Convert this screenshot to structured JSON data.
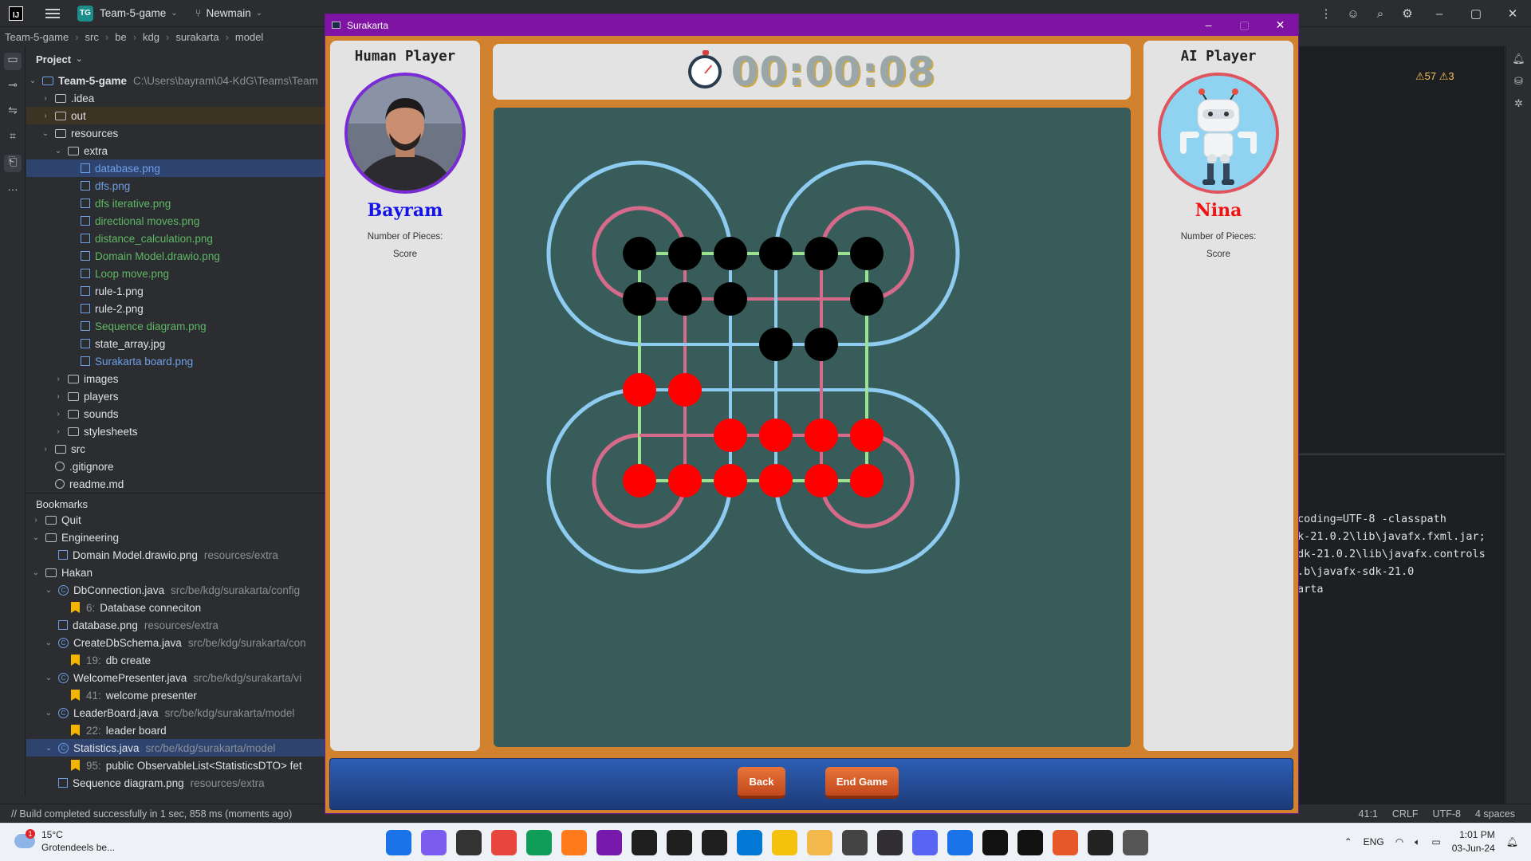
{
  "ide": {
    "project_badge": "TG",
    "project_name": "Team-5-game",
    "branch": "Newmain",
    "breadcrumb": [
      "Team-5-game",
      "src",
      "be",
      "kdg",
      "surakarta",
      "model"
    ],
    "project_panel_title": "Project",
    "project_root": "Team-5-game",
    "project_root_path": "C:\\Users\\bayram\\04-KdG\\Teams\\Team",
    "tree": [
      {
        "label": ".idea",
        "kind": "folder",
        "depth": 1,
        "open": false
      },
      {
        "label": "out",
        "kind": "folder",
        "depth": 1,
        "open": false,
        "hl": true
      },
      {
        "label": "resources",
        "kind": "folder",
        "depth": 1,
        "open": true
      },
      {
        "label": "extra",
        "kind": "folder",
        "depth": 2,
        "open": true
      },
      {
        "label": "database.png",
        "kind": "image",
        "depth": 3,
        "selected": true
      },
      {
        "label": "dfs.png",
        "kind": "image",
        "depth": 3,
        "color": "blue"
      },
      {
        "label": "dfs iterative.png",
        "kind": "image",
        "depth": 3,
        "color": "green"
      },
      {
        "label": "directional moves.png",
        "kind": "image",
        "depth": 3,
        "color": "green"
      },
      {
        "label": "distance_calculation.png",
        "kind": "image",
        "depth": 3,
        "color": "green"
      },
      {
        "label": "Domain Model.drawio.png",
        "kind": "image",
        "depth": 3,
        "color": "green"
      },
      {
        "label": "Loop move.png",
        "kind": "image",
        "depth": 3,
        "color": "green"
      },
      {
        "label": "rule-1.png",
        "kind": "image",
        "depth": 3
      },
      {
        "label": "rule-2.png",
        "kind": "image",
        "depth": 3
      },
      {
        "label": "Sequence diagram.png",
        "kind": "image",
        "depth": 3,
        "color": "green"
      },
      {
        "label": "state_array.jpg",
        "kind": "image",
        "depth": 3
      },
      {
        "label": "Surakarta board.png",
        "kind": "image",
        "depth": 3,
        "color": "blue"
      },
      {
        "label": "images",
        "kind": "folder",
        "depth": 2,
        "open": false
      },
      {
        "label": "players",
        "kind": "folder",
        "depth": 2,
        "open": false
      },
      {
        "label": "sounds",
        "kind": "folder",
        "depth": 2,
        "open": false
      },
      {
        "label": "stylesheets",
        "kind": "folder",
        "depth": 2,
        "open": false
      },
      {
        "label": "src",
        "kind": "folder",
        "depth": 1,
        "open": false
      },
      {
        "label": ".gitignore",
        "kind": "file",
        "depth": 1
      },
      {
        "label": "readme.md",
        "kind": "file",
        "depth": 1
      }
    ],
    "bookmarks_title": "Bookmarks",
    "bookmarks": [
      {
        "label": "Quit",
        "kind": "list",
        "depth": 0
      },
      {
        "label": "Engineering",
        "kind": "list",
        "depth": 0,
        "open": true
      },
      {
        "label": "Domain Model.drawio.png",
        "hint": "resources/extra",
        "kind": "image",
        "depth": 1
      },
      {
        "label": "Hakan",
        "kind": "list",
        "depth": 0,
        "open": true
      },
      {
        "label": "DbConnection.java",
        "hint": "src/be/kdg/surakarta/config",
        "kind": "class",
        "depth": 1
      },
      {
        "label": "Database conneciton",
        "num": "6:",
        "kind": "mark",
        "depth": 2
      },
      {
        "label": "database.png",
        "hint": "resources/extra",
        "kind": "image",
        "depth": 1
      },
      {
        "label": "CreateDbSchema.java",
        "hint": "src/be/kdg/surakarta/con",
        "kind": "class",
        "depth": 1
      },
      {
        "label": "db create",
        "num": "19:",
        "kind": "mark",
        "depth": 2
      },
      {
        "label": "WelcomePresenter.java",
        "hint": "src/be/kdg/surakarta/vi",
        "kind": "class",
        "depth": 1
      },
      {
        "label": "welcome presenter",
        "num": "41:",
        "kind": "mark",
        "depth": 2
      },
      {
        "label": "LeaderBoard.java",
        "hint": "src/be/kdg/surakarta/model",
        "kind": "class",
        "depth": 1
      },
      {
        "label": "leader board",
        "num": "22:",
        "kind": "mark",
        "depth": 2
      },
      {
        "label": "Statistics.java",
        "hint": "src/be/kdg/surakarta/model",
        "kind": "class",
        "depth": 1,
        "selected": true
      },
      {
        "label": "public ObservableList<StatisticsDTO> fet",
        "num": "95:",
        "kind": "mark",
        "depth": 2
      },
      {
        "label": "Sequence diagram.png",
        "hint": "resources/extra",
        "kind": "image",
        "depth": 1
      }
    ],
    "warnings": "⚠57 ⚠3",
    "terminal_lines": [
      "coding=UTF-8 -classpath",
      "k-21.0.2\\lib\\javafx.fxml.jar;",
      "dk-21.0.2\\lib\\javafx.controls",
      ".b\\javafx-sdk-21.0",
      "arta"
    ],
    "status_message": "// Build completed successfully in 1 sec, 858 ms (moments ago)",
    "status_right": [
      "41:1",
      "CRLF",
      "UTF-8",
      "4 spaces"
    ]
  },
  "game": {
    "window_title": "Surakarta",
    "human_header": "Human Player",
    "human_name": "Bayram",
    "ai_header": "AI Player",
    "ai_name": "Nina",
    "pieces_label": "Number of Pieces:",
    "score_label": "Score",
    "timer": "00:00:08",
    "back_label": "Back",
    "end_label": "End Game",
    "board": {
      "rows": [
        "BBBBBB",
        "BBB..B",
        "...BB.",
        "RR....",
        "..RRRR",
        "RRRRRR"
      ],
      "colors": {
        "board_bg": "#385c5a",
        "inner_loop": "#d66a8a",
        "outer_loop": "#8ecbf0",
        "grid": "#9be38f",
        "black_piece": "#000000",
        "red_piece": "#ff0000"
      }
    }
  },
  "taskbar": {
    "weather_temp": "15°C",
    "weather_desc": "Grotendeels be...",
    "notification_count": "1",
    "apps": [
      "start",
      "copilot",
      "explorer-win",
      "chrome",
      "edge",
      "firefox",
      "onenote",
      "intellij",
      "webstorm",
      "datagrip",
      "vscode",
      "sticky",
      "files",
      "kdg",
      "obs",
      "discord",
      "maps",
      "notion",
      "calendar",
      "office",
      "terminal",
      "surakarta"
    ],
    "lang": "ENG",
    "time": "1:01 PM",
    "date": "03-Jun-24"
  }
}
